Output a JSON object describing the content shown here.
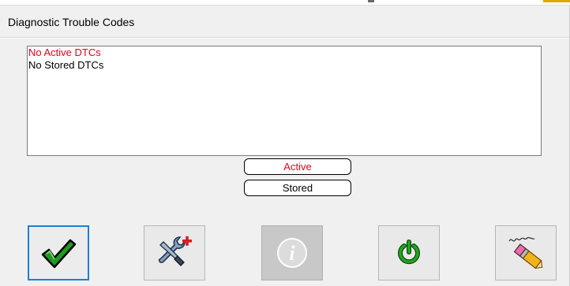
{
  "dialog": {
    "title": "Diagnostic Trouble Codes"
  },
  "dtc_list": {
    "lines": [
      {
        "text": "No Active DTCs",
        "color": "#e8001c"
      },
      {
        "text": "No Stored DTCs",
        "color": "#000000"
      }
    ]
  },
  "filters": {
    "active_label": "Active",
    "stored_label": "Stored"
  },
  "toolbar": {
    "buttons": [
      {
        "icon": "checkmark-icon",
        "state": "selected"
      },
      {
        "icon": "wrench-add-icon",
        "state": "enabled"
      },
      {
        "icon": "info-icon",
        "state": "disabled"
      },
      {
        "icon": "power-icon",
        "state": "enabled"
      },
      {
        "icon": "eraser-icon",
        "state": "enabled"
      }
    ]
  },
  "colors": {
    "active_text": "#e8001c",
    "focus_border": "#1e7fd4",
    "check_green": "#1f9a1f",
    "power_green": "#23a623"
  }
}
